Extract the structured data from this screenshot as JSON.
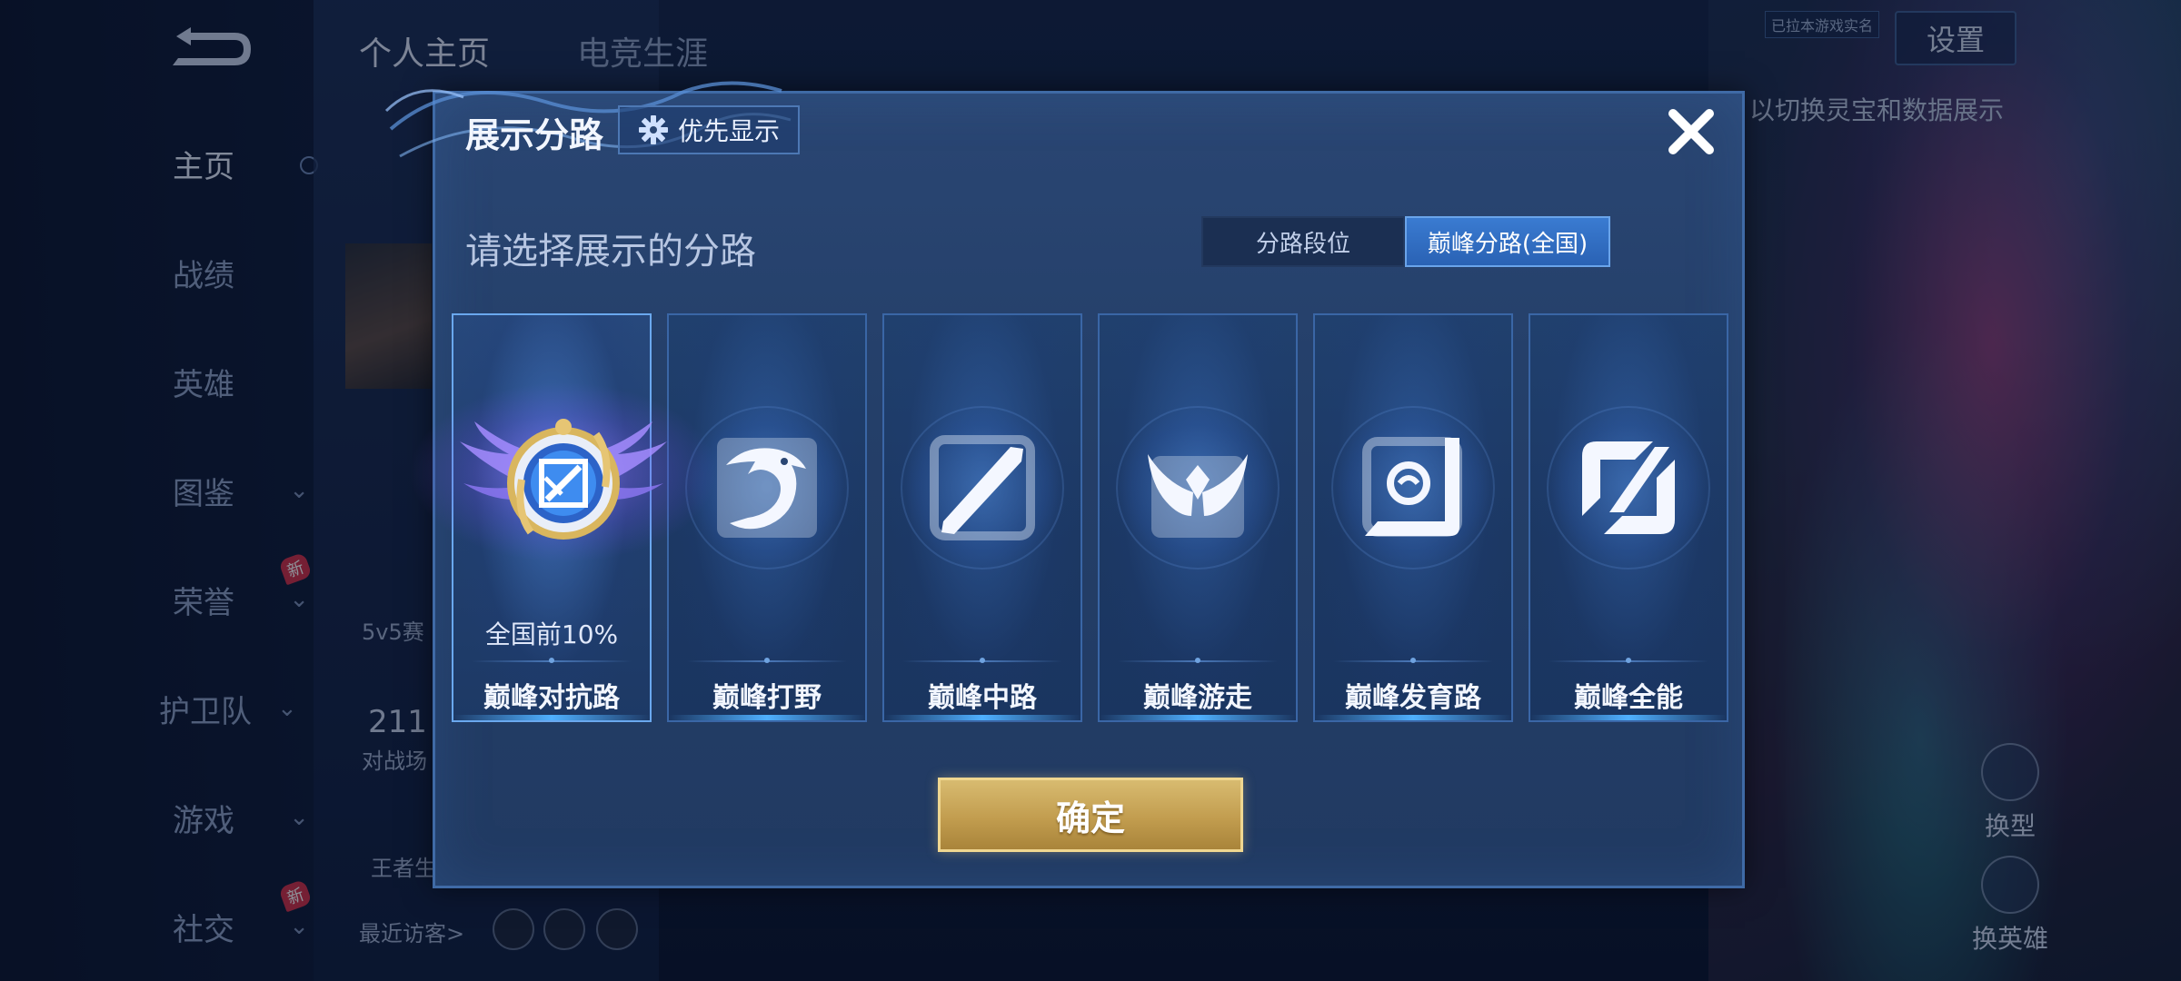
{
  "background": {
    "top_tabs": [
      "个人主页",
      "电竞生涯"
    ],
    "nav": [
      {
        "label": "主页",
        "has_chevron": false,
        "new": false
      },
      {
        "label": "战绩",
        "has_chevron": false,
        "new": false
      },
      {
        "label": "英雄",
        "has_chevron": false,
        "new": false
      },
      {
        "label": "图鉴",
        "has_chevron": true,
        "new": false
      },
      {
        "label": "荣誉",
        "has_chevron": true,
        "new": true
      },
      {
        "label": "护卫队",
        "has_chevron": true,
        "new": false
      },
      {
        "label": "游戏",
        "has_chevron": true,
        "new": false
      },
      {
        "label": "社交",
        "has_chevron": true,
        "new": true
      }
    ],
    "new_badge": "新",
    "settings_label": "设置",
    "fav_tag": "已拉本游戏实名",
    "hint_text": "以切换灵宝和数据展示",
    "mode_text": "5v5赛",
    "count_text": "211",
    "count_label": "对战场",
    "glory_text": "王者生",
    "recent_visitors_label": "最近访客>",
    "side_actions": [
      "换型",
      "换英雄"
    ]
  },
  "dialog": {
    "title": "展示分路",
    "priority_button": "优先显示",
    "subtitle": "请选择展示的分路",
    "tabs": [
      {
        "label": "分路段位",
        "active": false
      },
      {
        "label": "巅峰分路(全国)",
        "active": true
      }
    ],
    "roles": [
      {
        "name": "巅峰对抗路",
        "rank": "全国前10%",
        "icon": "rank-emblem-icon",
        "selected": true
      },
      {
        "name": "巅峰打野",
        "rank": "",
        "icon": "jungle-dragon-icon",
        "selected": false
      },
      {
        "name": "巅峰中路",
        "rank": "",
        "icon": "mid-slash-icon",
        "selected": false
      },
      {
        "name": "巅峰游走",
        "rank": "",
        "icon": "support-wings-icon",
        "selected": false
      },
      {
        "name": "巅峰发育路",
        "rank": "",
        "icon": "adc-target-icon",
        "selected": false
      },
      {
        "name": "巅峰全能",
        "rank": "",
        "icon": "all-round-icon",
        "selected": false
      }
    ],
    "confirm_label": "确定"
  },
  "colors": {
    "dialog_bg": "#243f69",
    "accent_blue": "#3a7bd1",
    "confirm_gold": "#c29d4f",
    "badge_red": "#d2314a"
  }
}
